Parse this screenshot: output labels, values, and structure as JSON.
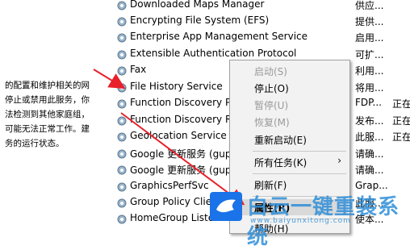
{
  "description_lines": [
    "的配置和维护相关的网",
    "停止或禁用此服务，你",
    "法检测到其他家庭组，",
    "可能无法正常工作。建",
    "务的运行状态。"
  ],
  "services": [
    {
      "name": "Downloaded Maps Manager",
      "desc": "供应...",
      "status": ""
    },
    {
      "name": "Encrypting File System (EFS)",
      "desc": "提供...",
      "status": ""
    },
    {
      "name": "Enterprise App Management Service",
      "desc": "启用...",
      "status": ""
    },
    {
      "name": "Extensible Authentication Protocol",
      "desc": "可扩...",
      "status": ""
    },
    {
      "name": "Fax",
      "desc": "利用...",
      "status": ""
    },
    {
      "name": "File History Service",
      "desc": "将用...",
      "status": ""
    },
    {
      "name": "Function Discovery Provider",
      "desc": "FDP...",
      "status": "正在"
    },
    {
      "name": "Function Discovery Re",
      "desc": "发布...",
      "status": "正在"
    },
    {
      "name": "Geolocation Service",
      "desc": "此服...",
      "status": "正在"
    },
    {
      "name": "Google 更新服务 (gup",
      "desc": "请确...",
      "status": ""
    },
    {
      "name": "Google 更新服务 (gup",
      "desc": "请确...",
      "status": ""
    },
    {
      "name": "GraphicsPerfSvc",
      "desc": "Grap...",
      "status": ""
    },
    {
      "name": "Group Policy Clie",
      "desc": "此服...",
      "status": ""
    },
    {
      "name": "HomeGroup Liste",
      "desc": "使本...",
      "status": ""
    }
  ],
  "context_menu": {
    "start": "启动(S)",
    "stop": "停止(O)",
    "pause": "暂停(U)",
    "resume": "恢复(M)",
    "restart": "重新启动(E)",
    "all_tasks": "所有任务(K)",
    "refresh": "刷新(F)",
    "properties": "属性(R)",
    "help": "帮助(H)"
  },
  "watermark": {
    "brand": "白云一键重装系统",
    "url": "www.baiyunxitong.com"
  },
  "colors": {
    "arrow": "#e8202a",
    "watermark": "#2f8fd8",
    "menu_bg": "#f2f2f2"
  }
}
